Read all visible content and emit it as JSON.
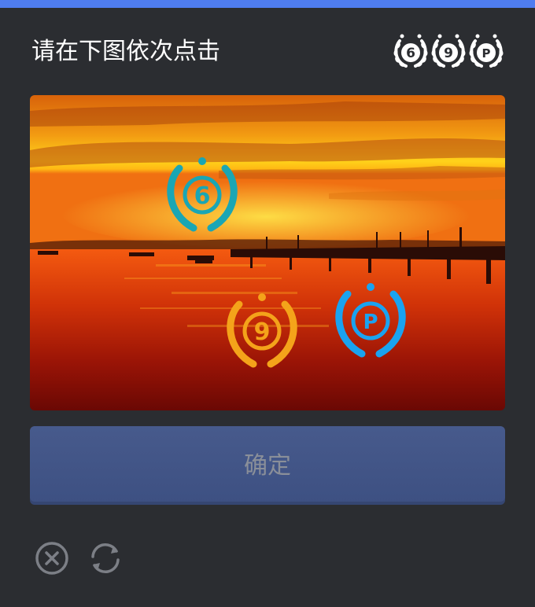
{
  "header": {
    "title": "请在下图依次点击"
  },
  "targets": [
    {
      "char": "6",
      "icon": "laurel-badge-icon"
    },
    {
      "char": "9",
      "icon": "laurel-badge-icon"
    },
    {
      "char": "P",
      "icon": "laurel-badge-icon"
    }
  ],
  "image": {
    "scene": "sunset-pier-icon",
    "badges": [
      {
        "char": "6",
        "color": "#1aa6b4"
      },
      {
        "char": "9",
        "color": "#f4a31a"
      },
      {
        "char": "P",
        "color": "#1aa3f0"
      }
    ]
  },
  "actions": {
    "confirm_label": "确定",
    "close_icon": "close-circle-icon",
    "refresh_icon": "refresh-icon"
  },
  "colors": {
    "accent": "#4f7df0",
    "background": "#2b2d31",
    "button": "#42558a"
  }
}
